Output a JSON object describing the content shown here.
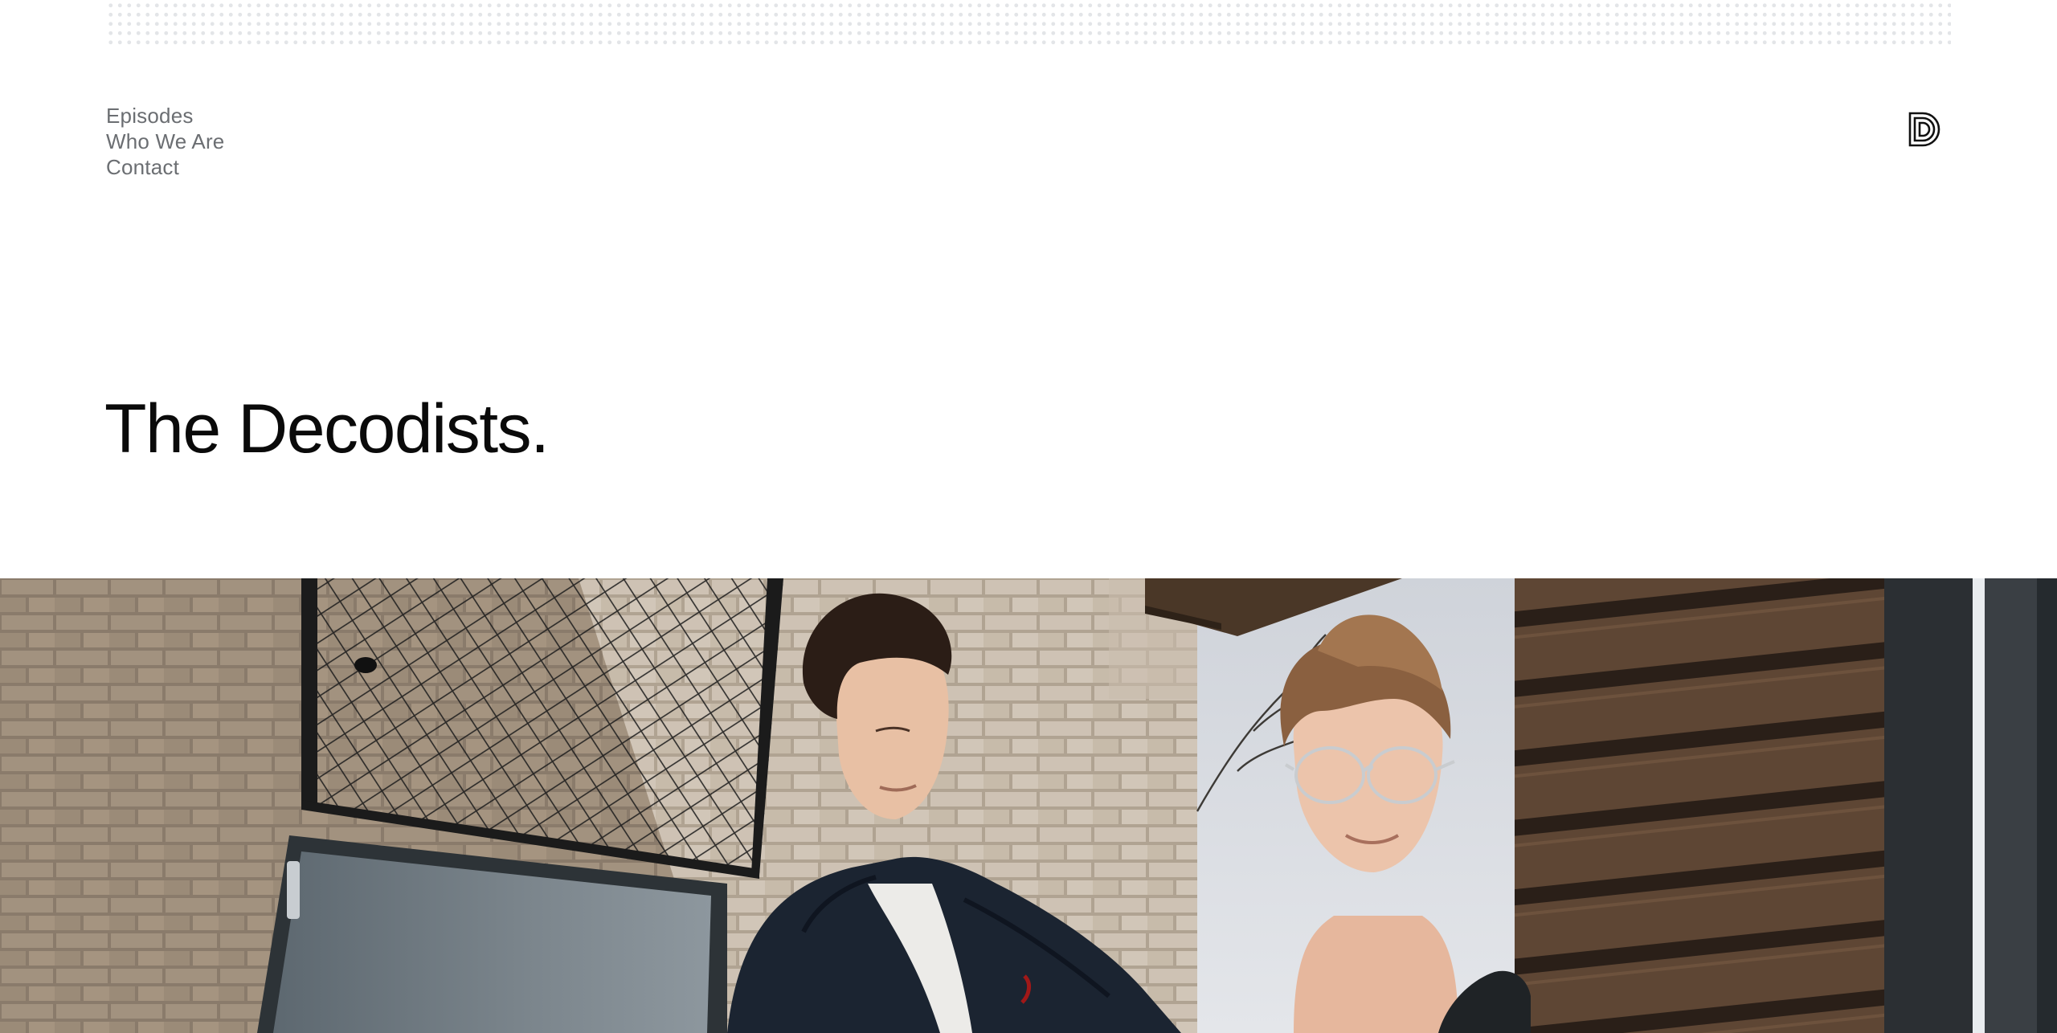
{
  "nav": {
    "items": [
      {
        "label": "Episodes"
      },
      {
        "label": "Who We Are"
      },
      {
        "label": "Contact"
      }
    ]
  },
  "logo": {
    "icon": "decodists-d-logo-icon"
  },
  "hero": {
    "title": "The Decodists.",
    "photo": "two-young-men-outside-brick-building-image"
  },
  "colors": {
    "background": "#ffffff",
    "nav_text": "#6b6e72",
    "title_text": "#0a0a0a",
    "dot_pattern": "#e3e5e8"
  }
}
